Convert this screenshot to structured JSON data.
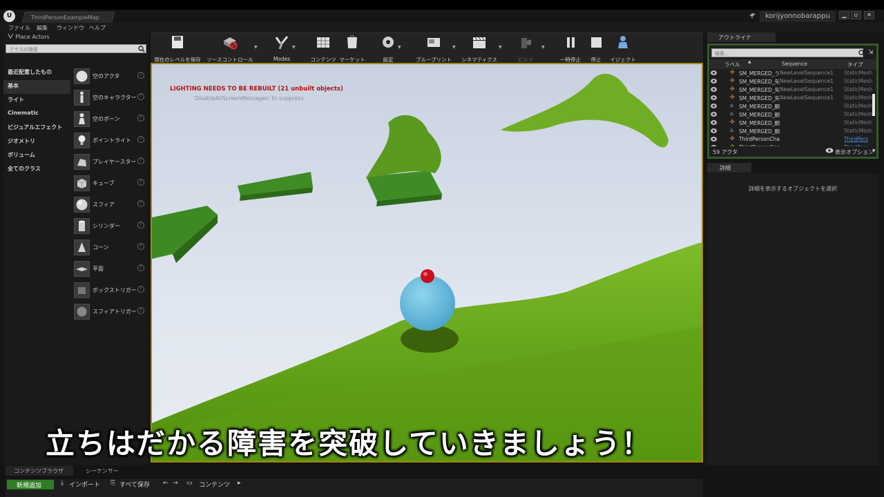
{
  "titlebar": {
    "map_tab": "ThirdPersonExampleMap",
    "username": "korijyonnobarappu",
    "logo": "U"
  },
  "menubar": [
    "ファイル",
    "編集",
    "ウィンドウ",
    "ヘルプ"
  ],
  "place_actors": {
    "tab": "Place Actors",
    "search_placeholder": "クラスの検索",
    "categories": [
      "最近配置したもの",
      "基本",
      "ライト",
      "Cinematic",
      "ビジュアルエフェクト",
      "ジオメトリ",
      "ボリューム",
      "全てのクラス"
    ],
    "selected_category": "基本",
    "actors": [
      "空のアクタ",
      "空のキャラクター",
      "空のポーン",
      "ポイントライト",
      "プレイヤースター",
      "キューブ",
      "スフィア",
      "シリンダー",
      "コーン",
      "平面",
      "ボックストリガー",
      "スフィアトリガー"
    ]
  },
  "toolbar": {
    "save": "現在のレベルを保存",
    "source_control": "ソースコントロール",
    "modes": "Modes",
    "content": "コンテンツ",
    "marketplace": "マーケット",
    "settings": "設定",
    "blueprints": "ブループリント",
    "cinematics": "シネマティクス",
    "build": "ビルド",
    "pause": "一時停止",
    "stop": "停止",
    "eject": "イジェクト"
  },
  "viewport": {
    "warning": "LIGHTING NEEDS TO BE REBUILT (21 unbuilt objects)",
    "warning_sub": "'DisableAllScreenMessages' to suppress"
  },
  "outliner": {
    "tab": "アウトライナ",
    "search_placeholder": "検索...",
    "columns": {
      "label": "ラベル",
      "sequence": "Sequence",
      "type": "タイプ"
    },
    "rows": [
      {
        "name": "SM_MERGED_う",
        "sequence": "NewLevelSequence1",
        "type": "StaticMesh",
        "icon": "puzzle"
      },
      {
        "name": "SM_MERGED_矢",
        "sequence": "NewLevelSequence1",
        "type": "StaticMesh",
        "icon": "puzzle"
      },
      {
        "name": "SM_MERGED_矢",
        "sequence": "NewLevelSequence1",
        "type": "StaticMesh",
        "icon": "puzzle"
      },
      {
        "name": "SM_MERGED_矢",
        "sequence": "NewLevelSequence1",
        "type": "StaticMesh",
        "icon": "puzzle"
      },
      {
        "name": "SM_MERGED_胴",
        "sequence": "",
        "type": "StaticMesh",
        "icon": "mesh"
      },
      {
        "name": "SM_MERGED_胴",
        "sequence": "",
        "type": "StaticMesh",
        "icon": "mesh"
      },
      {
        "name": "SM_MERGED_胴",
        "sequence": "",
        "type": "StaticMesh",
        "icon": "puzzle"
      },
      {
        "name": "SM_MERGED_胴",
        "sequence": "",
        "type": "StaticMesh",
        "icon": "mesh"
      },
      {
        "name": "ThirdPersonCha",
        "sequence": "",
        "type": "ThirdPers",
        "icon": "puzzle"
      },
      {
        "name": "ThirdPersonGan",
        "sequence": "",
        "type": "ThirdPers",
        "icon": "puzzle"
      }
    ],
    "actor_count": "59 アクタ",
    "view_options": "表示オプション"
  },
  "details": {
    "tab": "詳細",
    "hint": "詳細を表示するオブジェクトを選択"
  },
  "bottom": {
    "tabs": [
      "コンテンツブラウザ",
      "シーケンサー"
    ],
    "add_new": "新規追加",
    "import": "インポート",
    "save_all": "すべて保存",
    "breadcrumb": "コンテンツ"
  },
  "subtitle": "立ちはだかる障害を突破していきましょう！",
  "colors": {
    "accent_green": "#2f7d25",
    "viewport_border": "#a7880f",
    "outliner_border": "#325c26",
    "warning_red": "#b01414",
    "link_blue": "#4f8fe0"
  }
}
